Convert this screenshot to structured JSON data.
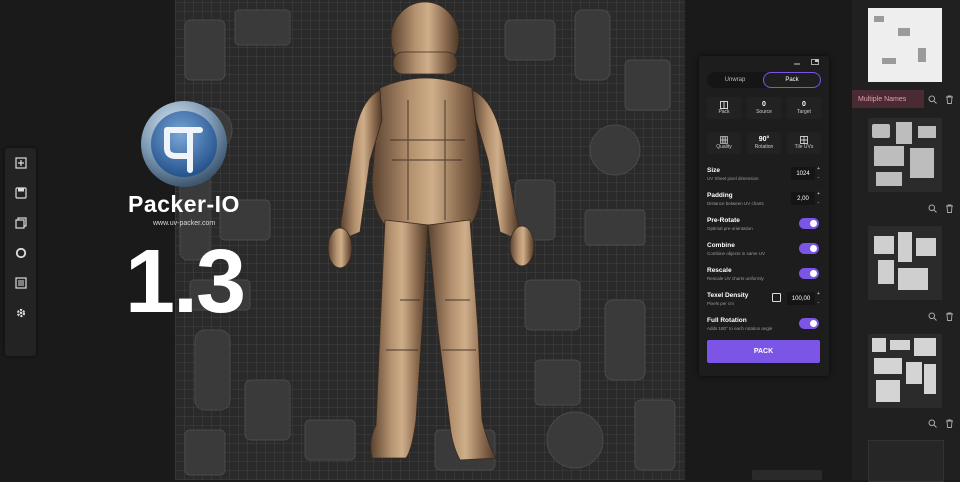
{
  "brand": {
    "name": "Packer-IO",
    "url": "www.uv-packer.com",
    "version": "1.3",
    "accent": "#7b55e6"
  },
  "left_toolbar": {
    "tools": [
      "add-icon",
      "save-icon",
      "layers-icon",
      "circle-icon",
      "list-icon",
      "gear-icon"
    ]
  },
  "pack_panel": {
    "tabs": [
      {
        "label": "Unwrap",
        "active": false
      },
      {
        "label": "Pack",
        "active": true
      }
    ],
    "stats_row1": [
      {
        "value": "",
        "label": "Pack",
        "icon": "pack-icon"
      },
      {
        "value": "0",
        "label": "Source"
      },
      {
        "value": "0",
        "label": "Target"
      }
    ],
    "stats_row2": [
      {
        "value": "",
        "label": "Quality",
        "icon": "grid-icon"
      },
      {
        "value": "90°",
        "label": "Rotation"
      },
      {
        "value": "",
        "label": "Tile UVs",
        "icon": "tiles-icon"
      }
    ],
    "options": {
      "size": {
        "title": "Size",
        "desc": "UV Sheet pixel dimension",
        "value": "1024"
      },
      "padding": {
        "title": "Padding",
        "desc": "Distance between UV charts",
        "value": "2,00"
      },
      "pre_rotate": {
        "title": "Pre-Rotate",
        "desc": "Optimal pre-orientation",
        "on": true
      },
      "combine": {
        "title": "Combine",
        "desc": "Combine objects in same UV",
        "on": true
      },
      "rescale": {
        "title": "Rescale",
        "desc": "Rescale UV charts uniformly",
        "on": true
      },
      "texel_density": {
        "title": "Texel Density",
        "desc": "Pixels per cm",
        "value": "100,00",
        "checked": false
      },
      "full_rotation": {
        "title": "Full Rotation",
        "desc": "Adds 180° to each rotation angle",
        "on": true
      }
    },
    "pack_button": "PACK"
  },
  "right_column": {
    "multi_names_label": "Multiple Names"
  }
}
